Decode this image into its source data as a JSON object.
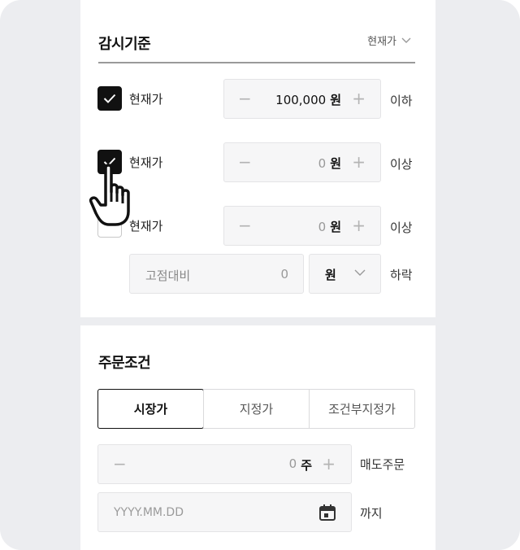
{
  "watch_criteria": {
    "title": "감시기준",
    "basis_select": {
      "value": "현재가"
    },
    "rows": [
      {
        "label": "현재가",
        "checked": true,
        "value": "100,000",
        "unit": "원",
        "condition": "이하"
      },
      {
        "label": "현재가",
        "checked": true,
        "value": "0",
        "unit": "원",
        "condition": "이상"
      },
      {
        "label": "현재가",
        "checked": false,
        "value": "0",
        "unit": "원",
        "condition": "이상"
      }
    ],
    "fixed_compare": {
      "placeholder": "고점대비",
      "value": "0",
      "unit": "원",
      "condition": "하락"
    }
  },
  "order_conditions": {
    "title": "주문조건",
    "tabs": [
      {
        "label": "시장가",
        "active": true
      },
      {
        "label": "지정가",
        "active": false
      },
      {
        "label": "조건부지정가",
        "active": false
      }
    ],
    "quantity": {
      "value": "0",
      "unit": "주",
      "label": "매도주문"
    },
    "until": {
      "placeholder": "YYYY.MM.DD",
      "label": "까지"
    }
  },
  "icons": {
    "stepper_minus": "−",
    "stepper_plus": "+"
  }
}
